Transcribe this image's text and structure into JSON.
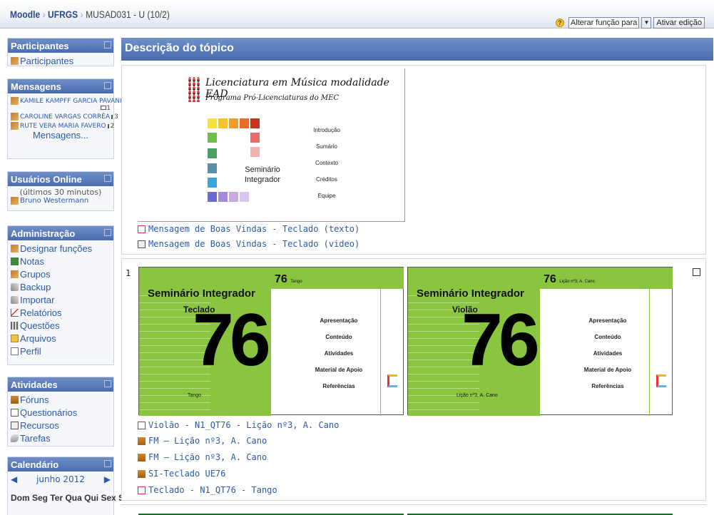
{
  "breadcrumb": {
    "home": "Moodle",
    "category": "UFRGS",
    "course": "MUSAD031 - U (10/2)"
  },
  "header_controls": {
    "role_label": "Alterar função para",
    "edit_button": "Ativar edição"
  },
  "blocks": {
    "participants": {
      "title": "Participantes",
      "items": [
        "Participantes"
      ]
    },
    "messages": {
      "title": "Mensagens",
      "senders": [
        {
          "name": "KAMILE KAMPFF GARCIA PAVANI",
          "count": "1"
        },
        {
          "name": "CAROLINE VARGAS CORRÊA",
          "count": "3"
        },
        {
          "name": "RUTE VERA MARIA FAVERO",
          "count": "2"
        }
      ],
      "more_link": "Mensagens..."
    },
    "online_users": {
      "title": "Usuários Online",
      "note": "(últimos 30 minutos)",
      "users": [
        "Bruno Westermann"
      ]
    },
    "administration": {
      "title": "Administração",
      "items": [
        "Designar funções",
        "Notas",
        "Grupos",
        "Backup",
        "Importar",
        "Relatórios",
        "Questões",
        "Arquivos",
        "Perfil"
      ]
    },
    "activities": {
      "title": "Atividades",
      "items": [
        "Fóruns",
        "Questionários",
        "Recursos",
        "Tarefas"
      ]
    },
    "calendar": {
      "title": "Calendário",
      "month": "junho 2012",
      "weekdays": "Dom Seg Ter Qua Qui Sex Sáb"
    }
  },
  "main": {
    "heading": "Descrição do tópico",
    "banner": {
      "title": "Licenciatura em Música modalidade EAD",
      "subtitle": "Programa Pró-Licenciaturas do MEC",
      "seminar": "Seminário Integrador",
      "menu": [
        "Introdução",
        "Sumário",
        "Contexto",
        "Créditos",
        "Equipe"
      ],
      "colors": [
        "#f2e33a",
        "#f5c22d",
        "#f29a2a",
        "#ea6a2a",
        "#c9321e",
        "#6fbf4a",
        "#e86a6a",
        "#f5b0b0",
        "#4aa060",
        "#5a90a8",
        "#3aa5d8",
        "#6a6ad0",
        "#a68ad8",
        "#c9a8e6",
        "#d8c8f0"
      ]
    },
    "intro_links": [
      "Mensagem de Boas Vindas - Teclado (texto)",
      "Mensagem de Boas Vindas - Teclado (video)"
    ],
    "section1": {
      "number": "1",
      "cards": [
        {
          "title": "Seminário Integrador",
          "instrument": "Teclado",
          "number": "76",
          "tag": "76",
          "tag_small": "Tango",
          "footer": "Tango",
          "menu": [
            "Apresentação",
            "Conteúdo",
            "Atividades",
            "Material de Apoio",
            "Referências"
          ]
        },
        {
          "title": "Seminário Integrador",
          "instrument": "Violão",
          "number": "76",
          "tag": "76",
          "tag_small": "Lição nº3, A. Cano",
          "footer": "Lição nº3, A. Cano",
          "menu": [
            "Apresentação",
            "Conteúdo",
            "Atividades",
            "Material de Apoio",
            "Referências"
          ]
        }
      ],
      "links": [
        "Violão - N1_QT76 - Lição nº3, A. Cano",
        "FM – Lição nº3, A. Cano",
        "FM – Lição nº3, A. Cano",
        "SI-Teclado UE76",
        "Teclado - N1_QT76 - Tango"
      ]
    }
  }
}
